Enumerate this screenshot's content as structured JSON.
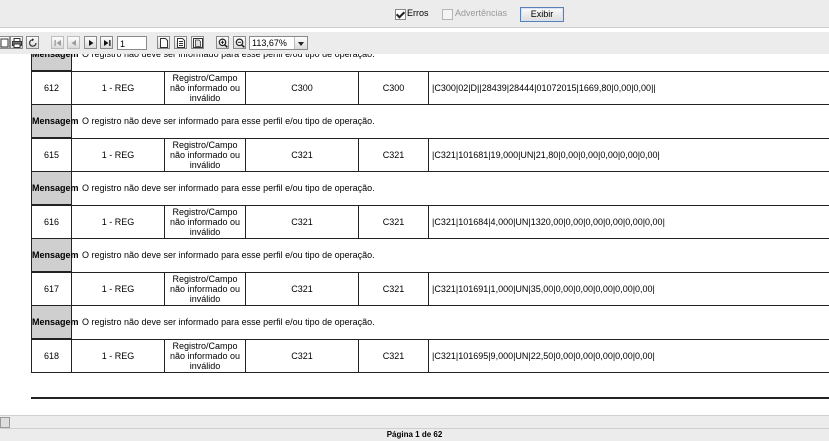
{
  "options": {
    "erros_label": "Erros",
    "erros_checked": true,
    "advertencias_label": "Advertências",
    "advertencias_checked": false,
    "exibir_label": "Exibir"
  },
  "toolbar": {
    "page_value": "1",
    "zoom_value": "113,67%"
  },
  "report": {
    "msg_label": "Mensagem",
    "top_partial_msg": "O registro não deve ser informado para esse perfil e/ou tipo de operação.",
    "rows": [
      {
        "num": "612",
        "reg": "1 - REG",
        "desc": "Registro/Campo não informado ou inválido",
        "reg2": "C300",
        "reg3": "C300",
        "line": "|C300|02|D||28439|28444|01072015|1669,80|0,00|0,00||",
        "msg": "O registro não deve ser informado para esse perfil e/ou tipo de operação."
      },
      {
        "num": "615",
        "reg": "1 - REG",
        "desc": "Registro/Campo não informado ou inválido",
        "reg2": "C321",
        "reg3": "C321",
        "line": "|C321|101681|19,000|UN|21,80|0,00|0,00|0,00|0,00|0,00|",
        "msg": "O registro não deve ser informado para esse perfil e/ou tipo de operação."
      },
      {
        "num": "616",
        "reg": "1 - REG",
        "desc": "Registro/Campo não informado ou inválido",
        "reg2": "C321",
        "reg3": "C321",
        "line": "|C321|101684|4,000|UN|1320,00|0,00|0,00|0,00|0,00|0,00|",
        "msg": "O registro não deve ser informado para esse perfil e/ou tipo de operação."
      },
      {
        "num": "617",
        "reg": "1 - REG",
        "desc": "Registro/Campo não informado ou inválido",
        "reg2": "C321",
        "reg3": "C321",
        "line": "|C321|101691|1,000|UN|35,00|0,00|0,00|0,00|0,00|0,00|",
        "msg": "O registro não deve ser informado para esse perfil e/ou tipo de operação."
      },
      {
        "num": "618",
        "reg": "1 - REG",
        "desc": "Registro/Campo não informado ou inválido",
        "reg2": "C321",
        "reg3": "C321",
        "line": "|C321|101695|9,000|UN|22,50|0,00|0,00|0,00|0,00|0,00|",
        "msg": null
      }
    ]
  },
  "status": {
    "page_text": "Página 1 de 62"
  }
}
